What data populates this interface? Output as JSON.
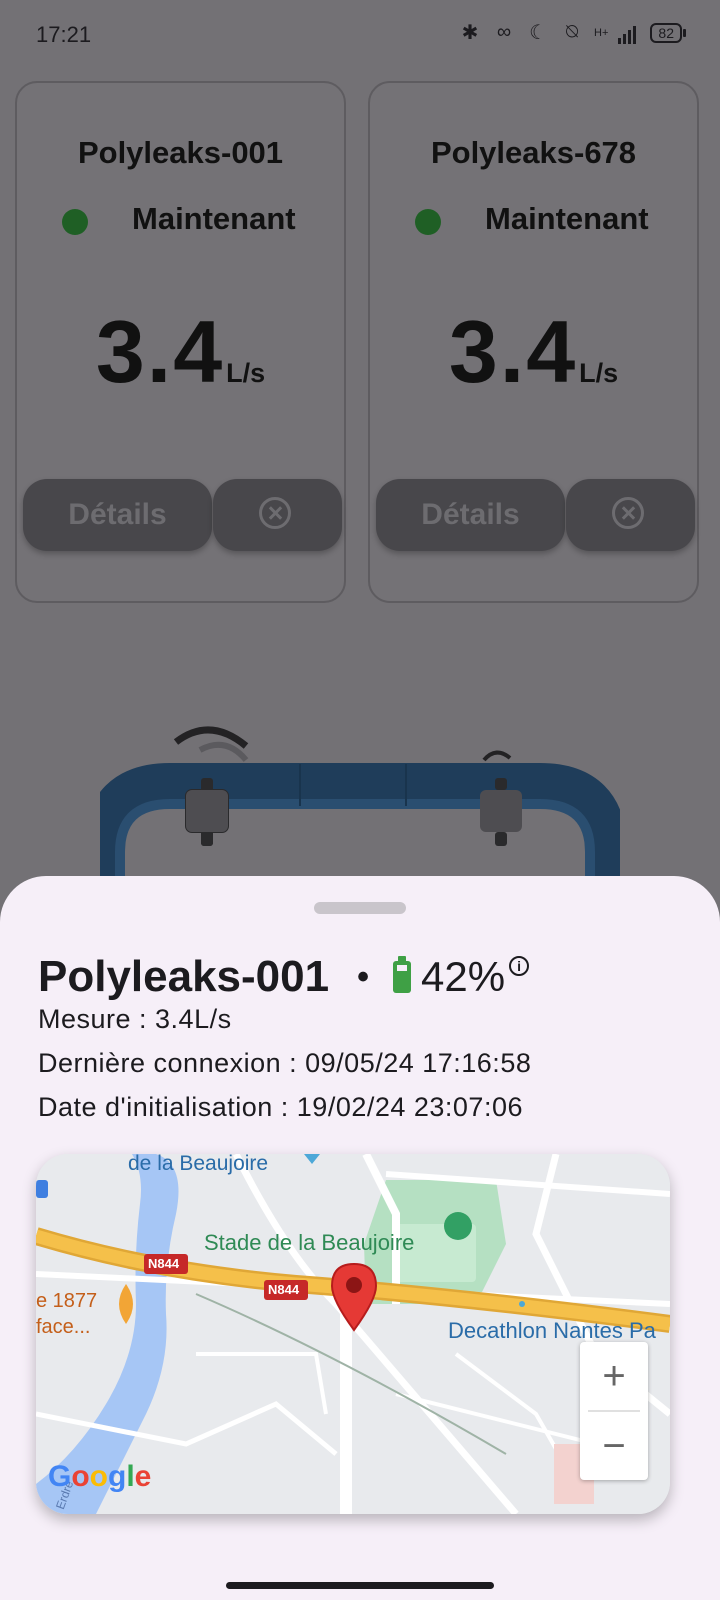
{
  "status_bar": {
    "time": "17:21",
    "network": "H+",
    "battery": "82"
  },
  "cards": [
    {
      "name": "Polyleaks-001",
      "status": "Maintenant",
      "value": "3.4",
      "unit": "L/s",
      "details_label": "Détails"
    },
    {
      "name": "Polyleaks-678",
      "status": "Maintenant",
      "value": "3.4",
      "unit": "L/s",
      "details_label": "Détails"
    }
  ],
  "sheet": {
    "title": "Polyleaks-001",
    "separator": "•",
    "battery_percent": "42%",
    "info_symbol": "i",
    "measure": "Mesure : 3.4L/s",
    "last_connection": "Dernière connexion : 09/05/24 17:16:58",
    "init_date": "Date d'initialisation : 19/02/24 23:07:06"
  },
  "map": {
    "labels": {
      "beaujoire_top": "de la Beaujoire",
      "stadium": "Stade de la Beaujoire",
      "road1": "N844",
      "road2": "N844",
      "restaurant": "e 1877",
      "restaurant2": "face...",
      "decathlon": "Decathlon Nantes Pa",
      "river": "Erdre"
    },
    "zoom_in": "+",
    "zoom_out": "−",
    "logo": [
      "G",
      "o",
      "o",
      "g",
      "l",
      "e"
    ]
  },
  "colors": {
    "status_online": "#1f5f25",
    "battery": "#3fa045",
    "pin": "#e53935",
    "road": "#f5c04a",
    "water": "#a6c6f5",
    "park": "#a8dab5"
  }
}
